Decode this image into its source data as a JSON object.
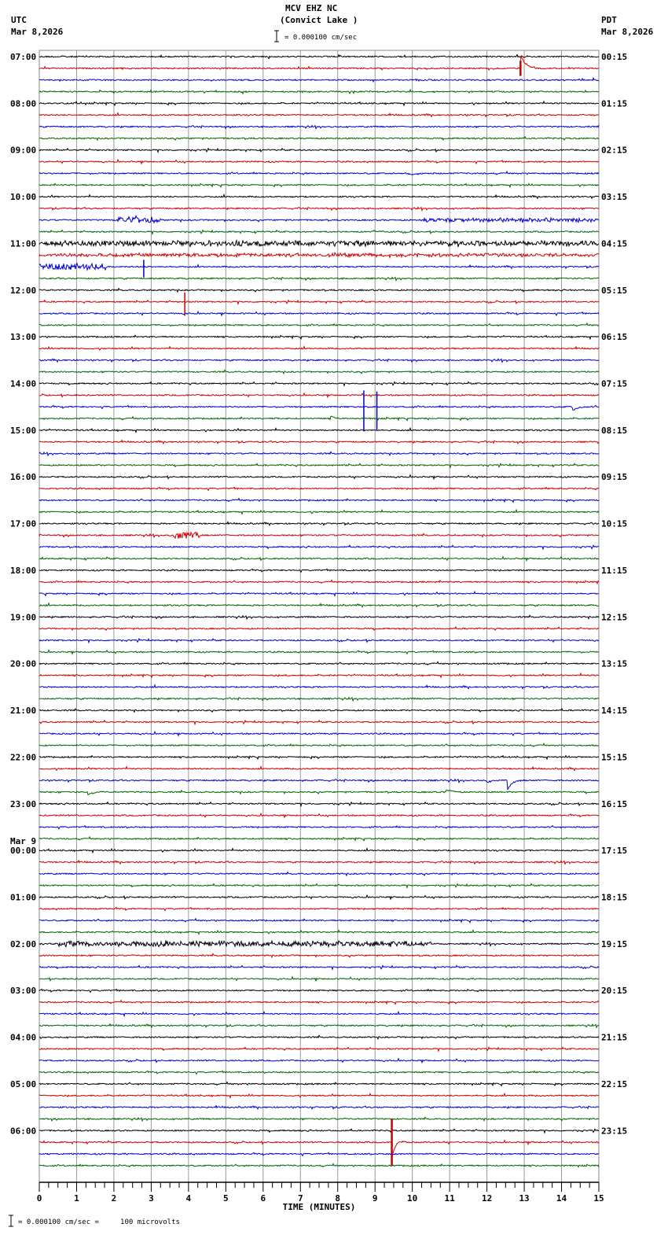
{
  "header": {
    "title": "MCV EHZ NC",
    "subtitle": "(Convict Lake )",
    "left_tz": "UTC",
    "left_date": "Mar 8,2026",
    "right_tz": "PDT",
    "right_date": "Mar 8,2026",
    "scale_text": "= 0.000100 cm/sec"
  },
  "footer": {
    "scale_text": "= 0.000100 cm/sec =     100 microvolts"
  },
  "chart_data": {
    "type": "line",
    "title": "MCV EHZ NC (Convict Lake )",
    "xlabel": "TIME (MINUTES)",
    "xlim": [
      0,
      15
    ],
    "x_ticks": [
      "0",
      "1",
      "2",
      "3",
      "4",
      "5",
      "6",
      "7",
      "8",
      "9",
      "10",
      "11",
      "12",
      "13",
      "14",
      "15"
    ],
    "grid": true,
    "traces_per_hour": 4,
    "trace_colors": [
      "#000000",
      "#cc0000",
      "#0000cc",
      "#006600"
    ],
    "left_labels": [
      "07:00",
      "08:00",
      "09:00",
      "10:00",
      "11:00",
      "12:00",
      "13:00",
      "14:00",
      "15:00",
      "16:00",
      "17:00",
      "18:00",
      "19:00",
      "20:00",
      "21:00",
      "22:00",
      "23:00",
      "Mar 9\n00:00",
      "01:00",
      "02:00",
      "03:00",
      "04:00",
      "05:00",
      "06:00"
    ],
    "right_labels": [
      "00:15",
      "01:15",
      "02:15",
      "03:15",
      "04:15",
      "05:15",
      "06:15",
      "07:15",
      "08:15",
      "09:15",
      "10:15",
      "11:15",
      "12:15",
      "13:15",
      "14:15",
      "15:15",
      "16:15",
      "17:15",
      "18:15",
      "19:15",
      "20:15",
      "21:15",
      "22:15",
      "23:15"
    ],
    "events": [
      {
        "trace": 1,
        "minute": 12.9,
        "amp": 1.3,
        "type": "quake"
      },
      {
        "trace": 10,
        "minute": 9.9,
        "amp": 0.3,
        "type": "quake"
      },
      {
        "trace": 14,
        "minute": 2.1,
        "end": 3.3,
        "amp": 0.25,
        "type": "noise"
      },
      {
        "trace": 14,
        "minute": 10.2,
        "end": 15,
        "amp": 0.15,
        "type": "noise"
      },
      {
        "trace": 15,
        "minute": 8.9,
        "amp": 0.3,
        "type": "quake"
      },
      {
        "trace": 16,
        "minute": 0,
        "end": 15,
        "amp": 0.2,
        "type": "noise"
      },
      {
        "trace": 17,
        "minute": 0,
        "end": 15,
        "amp": 0.12,
        "type": "noise"
      },
      {
        "trace": 18,
        "minute": 0,
        "end": 1.8,
        "amp": 0.25,
        "type": "noise"
      },
      {
        "trace": 18,
        "minute": 2.8,
        "amp": 1.5,
        "type": "spike"
      },
      {
        "trace": 21,
        "minute": 3.9,
        "amp": 2.0,
        "type": "spike"
      },
      {
        "trace": 30,
        "minute": 8.7,
        "amp": 3.5,
        "type": "spike"
      },
      {
        "trace": 30,
        "minute": 9.05,
        "amp": 3.3,
        "type": "spike"
      },
      {
        "trace": 30,
        "minute": 14.3,
        "amp": 0.3,
        "type": "quake"
      },
      {
        "trace": 31,
        "minute": 6.3,
        "amp": 0.3,
        "type": "quake"
      },
      {
        "trace": 31,
        "minute": 7.8,
        "amp": 0.2,
        "type": "quake"
      },
      {
        "trace": 41,
        "minute": 3.6,
        "end": 4.3,
        "amp": 0.3,
        "type": "noise"
      },
      {
        "trace": 62,
        "minute": 12.55,
        "amp": 0.8,
        "type": "quake"
      },
      {
        "trace": 62,
        "minute": 12.0,
        "amp": 0.3,
        "type": "quake"
      },
      {
        "trace": 63,
        "minute": 1.3,
        "amp": 0.3,
        "type": "quake"
      },
      {
        "trace": 63,
        "minute": 10.9,
        "amp": 0.35,
        "type": "quake"
      },
      {
        "trace": 76,
        "minute": 0.5,
        "end": 10.5,
        "amp": 0.2,
        "type": "noise"
      },
      {
        "trace": 93,
        "minute": 9.45,
        "amp": 4.0,
        "type": "quake"
      }
    ]
  }
}
